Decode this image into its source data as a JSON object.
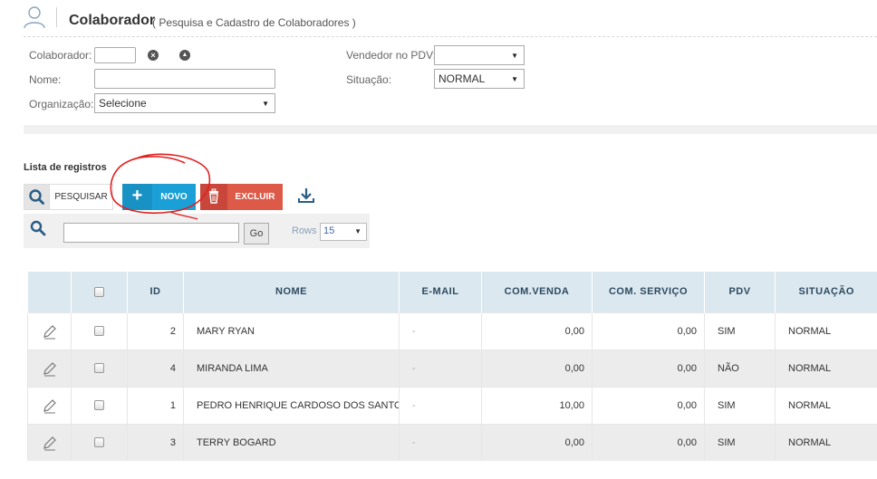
{
  "header": {
    "title": "Colaborador",
    "subtitle": "( Pesquisa e Cadastro de Colaboradores )"
  },
  "form": {
    "colaborador_label": "Colaborador:",
    "nome_label": "Nome:",
    "organizacao_label": "Organização:",
    "organizacao_value": "Selecione",
    "vendedor_label": "Vendedor no PDV:",
    "vendedor_value": "",
    "situacao_label": "Situação:",
    "situacao_value": "NORMAL"
  },
  "list": {
    "title": "Lista de registros"
  },
  "toolbar": {
    "pesquisar_label": "PESQUISAR",
    "novo_label": "NOVO",
    "excluir_label": "EXCLUIR"
  },
  "search": {
    "go_label": "Go",
    "rows_label": "Rows",
    "rows_value": "15"
  },
  "table": {
    "headers": [
      "ID",
      "NOME",
      "E-MAIL",
      "COM.VENDA",
      "COM. SERVIÇO",
      "PDV",
      "SITUAÇÃO"
    ],
    "rows": [
      {
        "id": "2",
        "nome": "MARY RYAN",
        "email": "-",
        "com_venda": "0,00",
        "com_servico": "0,00",
        "pdv": "SIM",
        "situacao": "NORMAL"
      },
      {
        "id": "4",
        "nome": "MIRANDA LIMA",
        "email": "-",
        "com_venda": "0,00",
        "com_servico": "0,00",
        "pdv": "NÃO",
        "situacao": "NORMAL"
      },
      {
        "id": "1",
        "nome": "PEDRO HENRIQUE CARDOSO DOS SANTOS",
        "email": "-",
        "com_venda": "10,00",
        "com_servico": "0,00",
        "pdv": "SIM",
        "situacao": "NORMAL"
      },
      {
        "id": "3",
        "nome": "TERRY BOGARD",
        "email": "-",
        "com_venda": "0,00",
        "com_servico": "0,00",
        "pdv": "SIM",
        "situacao": "NORMAL"
      }
    ]
  },
  "colors": {
    "novo_blue": "#1aa0d6",
    "excluir_red": "#dd5a48",
    "header_bg": "#dce8f0",
    "annotation_red": "#e02020"
  },
  "icons": [
    "user-icon",
    "clear-icon",
    "chevron-up-icon",
    "search-icon",
    "plus-icon",
    "trash-icon",
    "download-icon",
    "edit-icon"
  ]
}
